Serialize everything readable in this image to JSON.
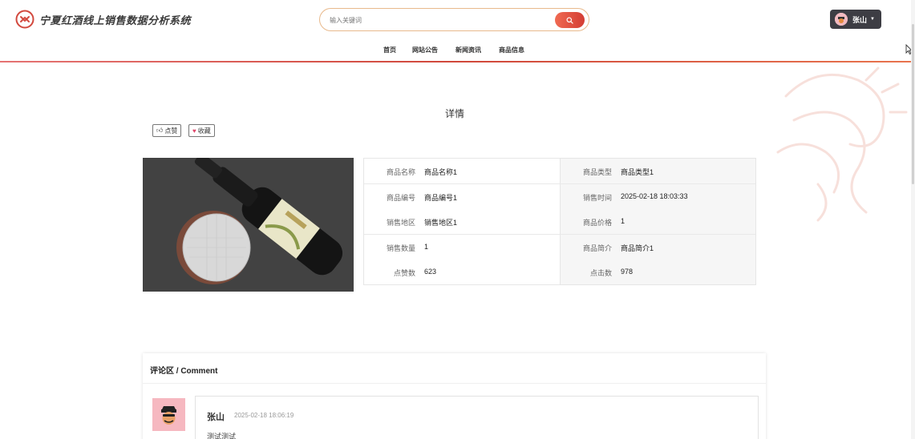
{
  "app": {
    "title": "宁夏红酒线上销售数据分析系统"
  },
  "search": {
    "placeholder": "输入关键词",
    "icon": "search-icon"
  },
  "user": {
    "name": "张山",
    "avatar_icon": "avatar-icon",
    "caret_icon": "caret-down-icon"
  },
  "nav": {
    "items": [
      "首页",
      "网站公告",
      "新闻资讯",
      "商品信息"
    ]
  },
  "page": {
    "title": "详情"
  },
  "actions": {
    "like": "点赞",
    "collect": "收藏"
  },
  "product": {
    "fields": [
      {
        "label": "商品名称",
        "value": "商品名称1"
      },
      {
        "label": "商品类型",
        "value": "商品类型1"
      },
      {
        "label": "商品编号",
        "value": "商品编号1"
      },
      {
        "label": "销售时间",
        "value": "2025-02-18 18:03:33"
      },
      {
        "label": "销售地区",
        "value": "销售地区1"
      },
      {
        "label": "商品价格",
        "value": "1"
      },
      {
        "label": "销售数量",
        "value": "1"
      },
      {
        "label": "商品简介",
        "value": "商品简介1"
      },
      {
        "label": "点赞数",
        "value": "623"
      },
      {
        "label": "点击数",
        "value": "978"
      }
    ]
  },
  "comments": {
    "title": "评论区 / Comment",
    "items": [
      {
        "user": "张山",
        "time": "2025-02-18 18:06:19",
        "text": "测试测试"
      }
    ]
  },
  "colors": {
    "accent": "#d33d34",
    "user_badge": "#3d3d44",
    "search_border": "#e8b98c"
  }
}
